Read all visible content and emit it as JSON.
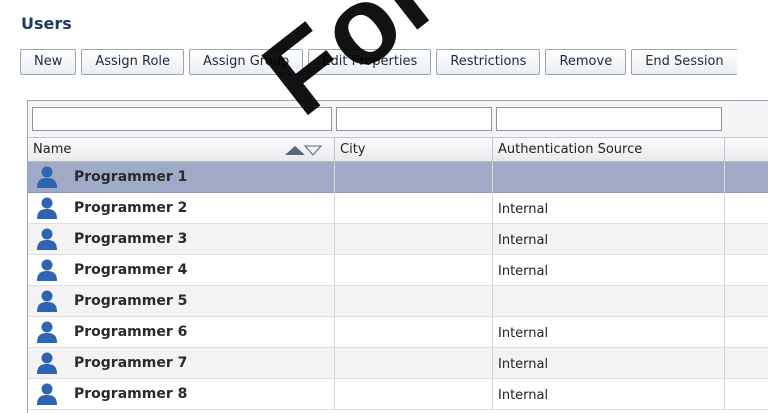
{
  "header": {
    "title": "Users"
  },
  "toolbar": {
    "buttons": [
      "New",
      "Assign Role",
      "Assign Group",
      "Edit Properties",
      "Restrictions",
      "Remove",
      "End Session"
    ]
  },
  "grid": {
    "columns": [
      "Name",
      "City",
      "Authentication Source"
    ],
    "sort": {
      "column": "Name",
      "icon": "sort-arrows-icon"
    },
    "rows": [
      {
        "name": "Programmer 1",
        "city": "",
        "auth": "",
        "selected": true
      },
      {
        "name": "Programmer 2",
        "city": "",
        "auth": "Internal"
      },
      {
        "name": "Programmer 3",
        "city": "",
        "auth": "Internal"
      },
      {
        "name": "Programmer 4",
        "city": "",
        "auth": "Internal"
      },
      {
        "name": "Programmer 5",
        "city": "",
        "auth": ""
      },
      {
        "name": "Programmer 6",
        "city": "",
        "auth": "Internal"
      },
      {
        "name": "Programmer 7",
        "city": "",
        "auth": "Internal"
      },
      {
        "name": "Programmer 8",
        "city": "",
        "auth": "Internal"
      }
    ],
    "row_icon": "user-icon"
  },
  "watermark": {
    "text": "For H"
  },
  "colors": {
    "selected_row": "#9faac6",
    "title": "#1f3a5f",
    "user_icon": "#2f64b0"
  }
}
